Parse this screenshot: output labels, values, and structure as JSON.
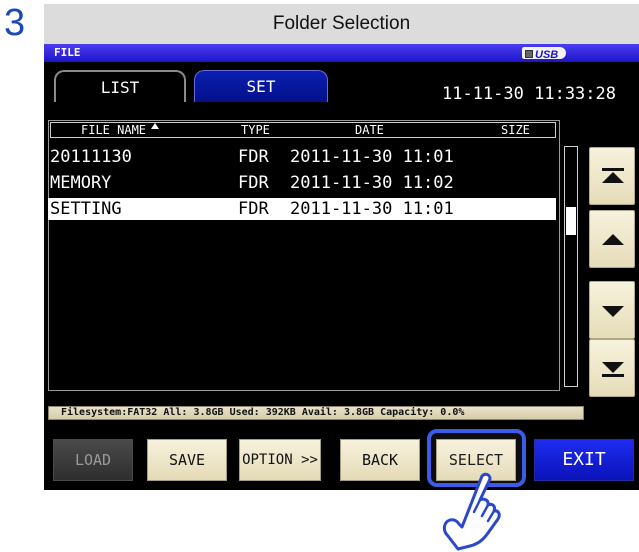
{
  "step": "3",
  "caption": "Folder Selection",
  "window": {
    "title": "FILE",
    "usb_label": "USB"
  },
  "tabs": [
    {
      "label": "LIST",
      "active": true
    },
    {
      "label": "SET",
      "active": false
    }
  ],
  "clock": "11-11-30 11:33:28",
  "table": {
    "headers": {
      "name": "FILE NAME",
      "type": "TYPE",
      "date": "DATE",
      "size": "SIZE"
    },
    "sort_column": "FILE NAME",
    "rows": [
      {
        "name": "20111130",
        "type": "FDR",
        "date": "2011-11-30 11:01",
        "selected": false
      },
      {
        "name": "MEMORY",
        "type": "FDR",
        "date": "2011-11-30 11:02",
        "selected": false
      },
      {
        "name": "SETTING",
        "type": "FDR",
        "date": "2011-11-30 11:01",
        "selected": true
      }
    ]
  },
  "status_bar": "Filesystem:FAT32 All: 3.8GB Used: 392KB Avail: 3.8GB Capacity: 0.0%",
  "buttons": {
    "load": "LOAD",
    "save": "SAVE",
    "option": "OPTION >>",
    "back": "BACK",
    "select": "SELECT",
    "exit": "EXIT"
  },
  "nav_icons": [
    "scroll-top-icon",
    "scroll-up-icon",
    "scroll-down-icon",
    "scroll-bottom-icon"
  ],
  "colors": {
    "accent_blue": "#1d14c8",
    "exit_blue": "#1f2df0",
    "button_beige": "#efe7c8",
    "highlight_blue": "#3a5ce8"
  }
}
